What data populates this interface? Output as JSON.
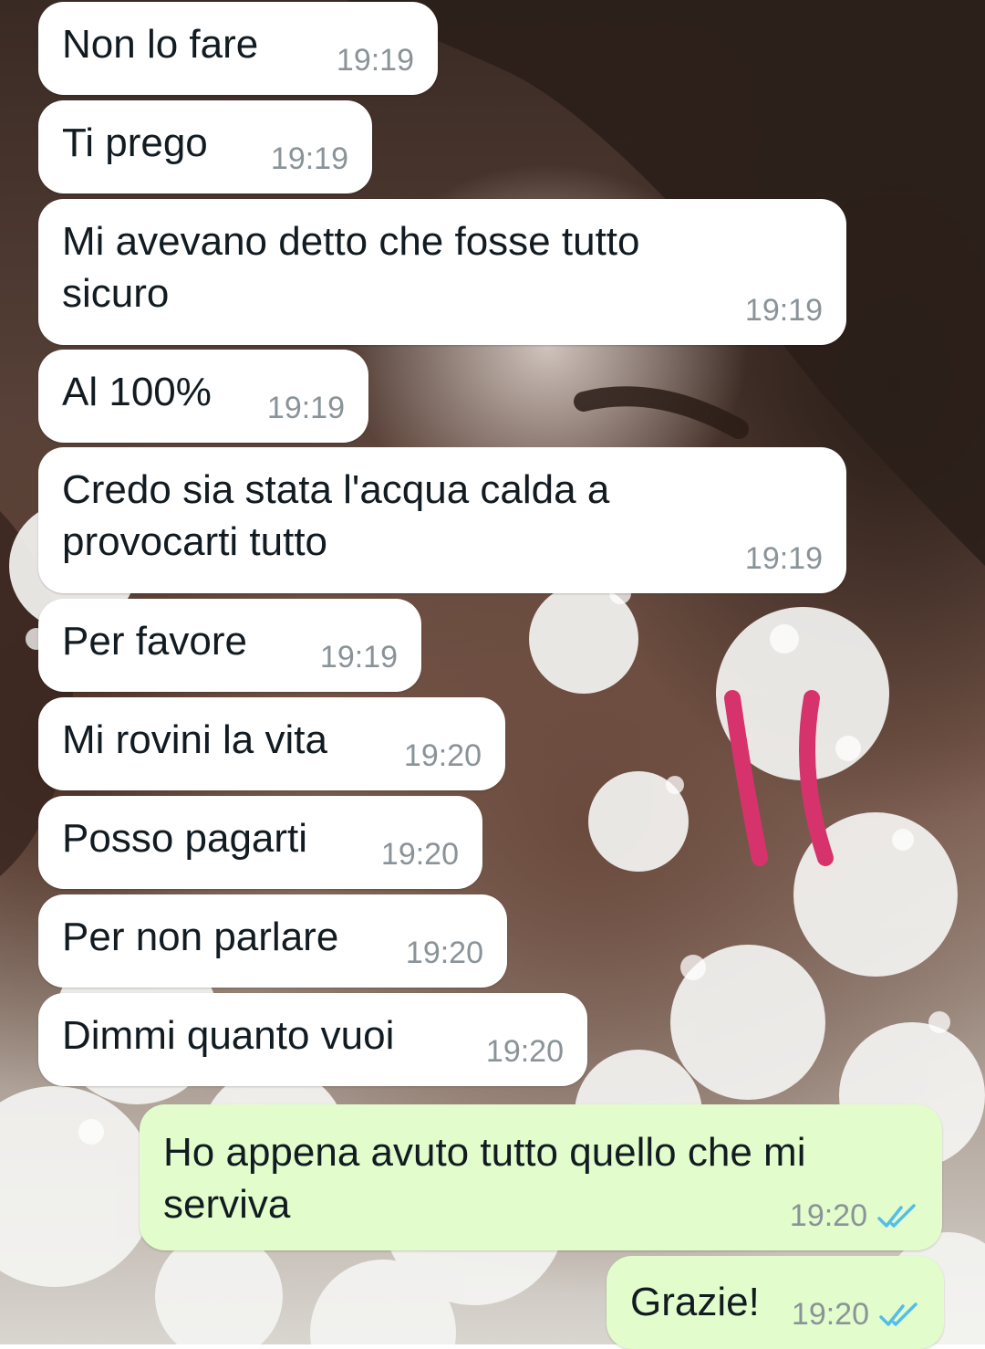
{
  "chat": {
    "messages": [
      {
        "text": "Non lo fare",
        "time": "19:19"
      },
      {
        "text": "Ti prego",
        "time": "19:19"
      },
      {
        "text": "Mi avevano detto che fosse tutto\nsicuro",
        "time": "19:19"
      },
      {
        "text": "Al 100%",
        "time": "19:19"
      },
      {
        "text": "Credo sia stata l'acqua calda a\nprovocarti tutto",
        "time": "19:19"
      },
      {
        "text": "Per favore",
        "time": "19:19"
      },
      {
        "text": "Mi rovini la vita",
        "time": "19:20"
      },
      {
        "text": "Posso pagarti",
        "time": "19:20"
      },
      {
        "text": "Per non parlare",
        "time": "19:20"
      },
      {
        "text": "Dimmi quanto vuoi",
        "time": "19:20"
      },
      {
        "text": "Ho appena avuto tutto quello che mi\nserviva",
        "time": "19:20",
        "status": "read"
      },
      {
        "text": "Grazie!",
        "time": "19:20",
        "status": "read"
      }
    ]
  },
  "colors": {
    "incoming_bubble": "#ffffff",
    "outgoing_bubble": "#e2fdcb",
    "read_ticks": "#53bdeb",
    "annotation_marks": "#d6336c"
  },
  "icons": {
    "read_status": "double-check-icon"
  }
}
